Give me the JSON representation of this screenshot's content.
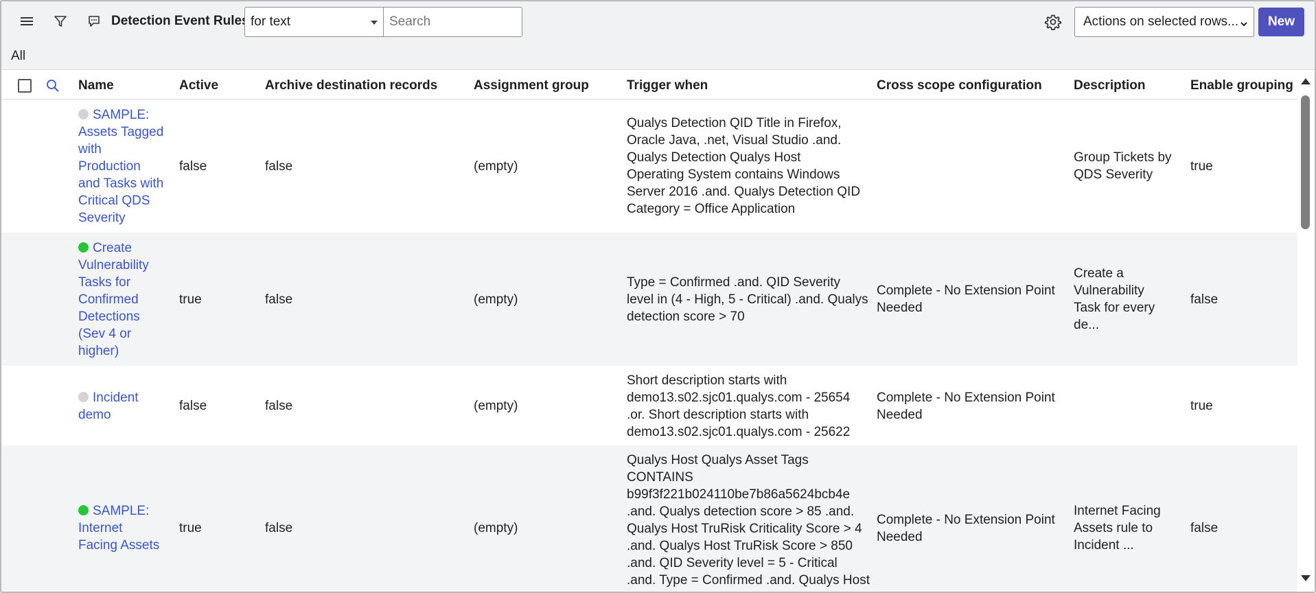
{
  "header": {
    "title": "Detection Event Rules",
    "filter_select": {
      "value": "for text"
    },
    "search": {
      "placeholder": "Search"
    },
    "actions_select": {
      "value": "Actions on selected rows..."
    },
    "new_label": "New"
  },
  "breadcrumb": {
    "label": "All"
  },
  "table": {
    "columns": [
      "Name",
      "Active",
      "Archive destination records",
      "Assignment group",
      "Trigger when",
      "Cross scope configuration",
      "Description",
      "Enable grouping"
    ],
    "rows": [
      {
        "status": "inactive",
        "name": [
          "SAMPLE:",
          "Assets Tagged",
          "with",
          "Production",
          "and Tasks with",
          "Critical QDS",
          "Severity"
        ],
        "active": "false",
        "archive": "false",
        "assignment": "(empty)",
        "trigger": [
          "Qualys Detection QID Title in Firefox,",
          "Oracle Java, .net, Visual Studio .and.",
          "Qualys Detection Qualys Host",
          "Operating System contains Windows",
          "Server 2016 .and. Qualys Detection QID",
          "Category = Office Application"
        ],
        "cross_scope": [],
        "description": [
          "Group Tickets by",
          "QDS Severity"
        ],
        "grouping": "true"
      },
      {
        "status": "active",
        "name": [
          "Create",
          "Vulnerability",
          "Tasks for",
          "Confirmed",
          "Detections",
          "(Sev 4 or",
          "higher)"
        ],
        "active": "true",
        "archive": "false",
        "assignment": "(empty)",
        "trigger": [
          "Type = Confirmed .and. QID Severity",
          "level in (4 - High, 5 - Critical) .and. Qualys",
          "detection score > 70"
        ],
        "cross_scope": [
          "Complete - No Extension Point",
          "Needed"
        ],
        "description": [
          "Create a",
          "Vulnerability",
          "Task for every",
          "de..."
        ],
        "grouping": "false"
      },
      {
        "status": "inactive",
        "name": [
          "Incident",
          "demo"
        ],
        "active": "false",
        "archive": "false",
        "assignment": "(empty)",
        "trigger": [
          "Short description starts with",
          "demo13.s02.sjc01.qualys.com - 25654",
          ".or. Short description starts with",
          "demo13.s02.sjc01.qualys.com - 25622"
        ],
        "cross_scope": [
          "Complete - No Extension Point",
          "Needed"
        ],
        "description": [],
        "grouping": "true"
      },
      {
        "status": "active",
        "name": [
          "SAMPLE:",
          "Internet",
          "Facing Assets"
        ],
        "active": "true",
        "archive": "false",
        "assignment": "(empty)",
        "trigger": [
          "Qualys Host Qualys Asset Tags",
          "CONTAINS",
          "b99f3f221b024110be7b86a5624bcb4e",
          ".and. Qualys detection score > 85 .and.",
          "Qualys Host TruRisk Criticality Score > 4",
          ".and. Qualys Host TruRisk Score > 850",
          ".and. QID Severity level = 5 - Critical",
          ".and. Type = Confirmed .and. Qualys Host"
        ],
        "cross_scope": [
          "Complete - No Extension Point",
          "Needed"
        ],
        "description": [
          "Internet Facing",
          "Assets rule to",
          "Incident ..."
        ],
        "grouping": "false"
      }
    ]
  },
  "colors": {
    "link": "#3a54c8",
    "primary": "#4f52bd",
    "active_dot": "#28c538",
    "inactive_dot": "#d3d3d3"
  }
}
